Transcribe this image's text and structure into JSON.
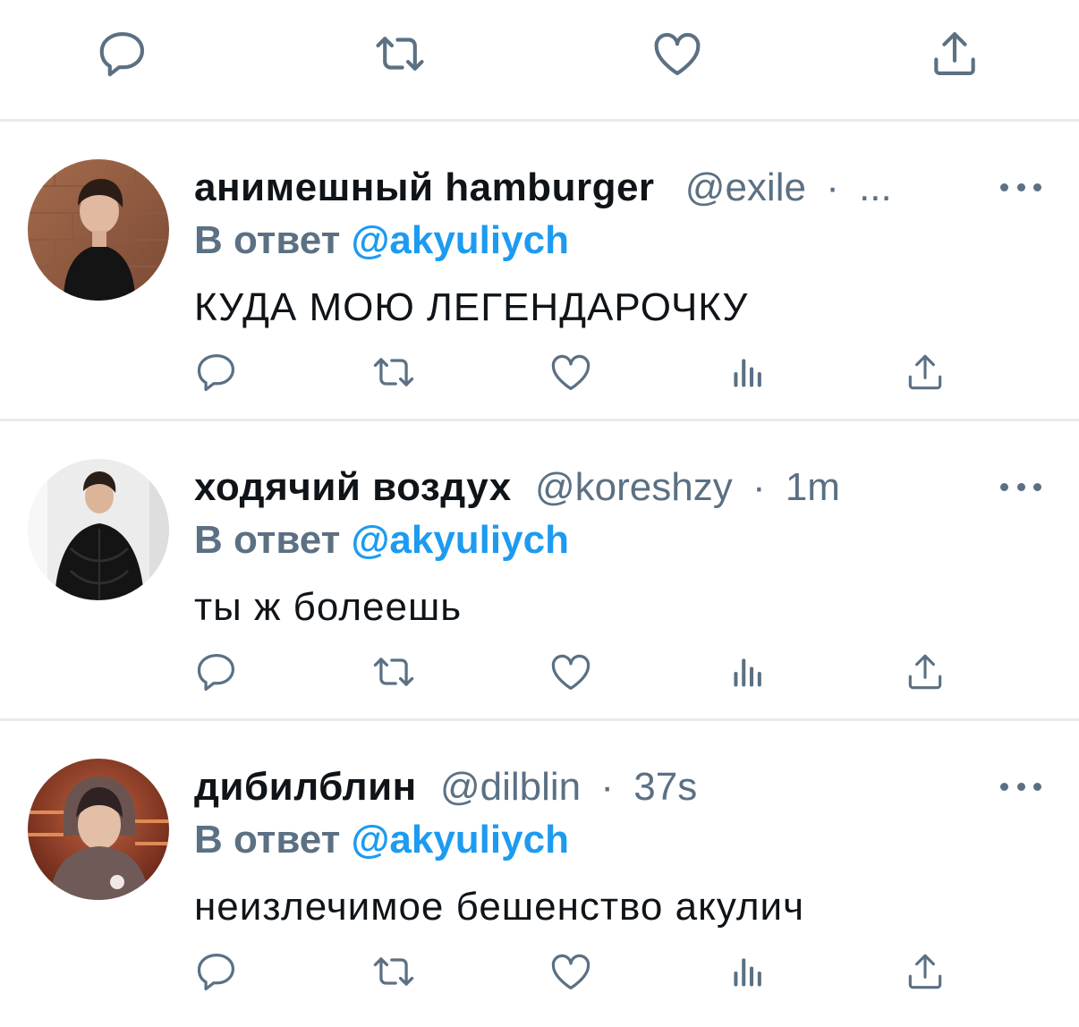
{
  "top_actions": {
    "icons": [
      "reply-icon",
      "retweet-icon",
      "like-icon",
      "share-icon"
    ]
  },
  "tweets": [
    {
      "display_name": "анимешный hamburger",
      "handle": "@exile",
      "separator": "·",
      "time": "...",
      "reply_prefix": "В ответ",
      "reply_to": "@akyuliych",
      "text": "КУДА МОЮ ЛЕГЕНДАРОЧКУ"
    },
    {
      "display_name": "ходячий воздух",
      "handle": "@koreshzy",
      "separator": "·",
      "time": "1m",
      "reply_prefix": "В ответ",
      "reply_to": "@akyuliych",
      "text": "ты ж болеешь"
    },
    {
      "display_name": "дибилблин",
      "handle": "@dilblin",
      "separator": "·",
      "time": "37s",
      "reply_prefix": "В ответ",
      "reply_to": "@akyuliych",
      "text": "неизлечимое бешенство акулич"
    }
  ],
  "colors": {
    "secondary_text": "#5b7083",
    "link": "#1d9bf0",
    "divider": "#e6ecf0",
    "icon": "#5b7083"
  }
}
